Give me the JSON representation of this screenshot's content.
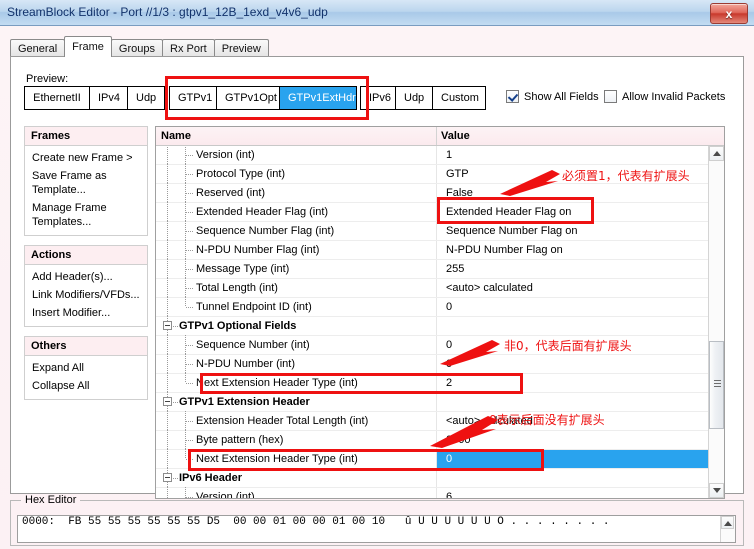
{
  "window": {
    "title": "StreamBlock Editor - Port //1/3 : gtpv1_12B_1exd_v4v6_udp",
    "close_label": "x"
  },
  "tabs": [
    {
      "label": "General",
      "active": false
    },
    {
      "label": "Frame",
      "active": true
    },
    {
      "label": "Groups",
      "active": false
    },
    {
      "label": "Rx Port",
      "active": false
    },
    {
      "label": "Preview",
      "active": false
    }
  ],
  "preview": {
    "label": "Preview:",
    "buttons": [
      {
        "label": "EthernetII",
        "selected": false
      },
      {
        "label": "IPv4",
        "selected": false
      },
      {
        "label": "Udp",
        "selected": false
      },
      {
        "label": "GTPv1",
        "selected": false
      },
      {
        "label": "GTPv1Opt",
        "selected": false
      },
      {
        "label": "GTPv1ExtHdr",
        "selected": true
      },
      {
        "label": "IPv6",
        "selected": false
      },
      {
        "label": "Udp",
        "selected": false
      },
      {
        "label": "Custom",
        "selected": false
      }
    ]
  },
  "options": {
    "show_all_fields": {
      "label": "Show All Fields",
      "checked": true
    },
    "allow_invalid_packets": {
      "label": "Allow Invalid Packets",
      "checked": false
    }
  },
  "sidebar": {
    "groups": [
      {
        "title": "Frames",
        "items": [
          {
            "label": "Create new Frame >"
          },
          {
            "label": "Save Frame as Template..."
          },
          {
            "label": "Manage Frame Templates..."
          }
        ]
      },
      {
        "title": "Actions",
        "items": [
          {
            "label": "Add Header(s)..."
          },
          {
            "label": "Link Modifiers/VFDs..."
          },
          {
            "label": "Insert Modifier..."
          }
        ]
      },
      {
        "title": "Others",
        "items": [
          {
            "label": "Expand All"
          },
          {
            "label": "Collapse All"
          }
        ]
      }
    ]
  },
  "grid": {
    "columns": {
      "name": "Name",
      "value": "Value"
    },
    "rows": [
      {
        "name": "Version (int)",
        "value": "1",
        "type": "leaf",
        "indent": 2
      },
      {
        "name": "Protocol Type (int)",
        "value": "GTP",
        "type": "leaf",
        "indent": 2
      },
      {
        "name": "Reserved (int)",
        "value": "False",
        "type": "leaf",
        "indent": 2
      },
      {
        "name": "Extended Header Flag (int)",
        "value": "Extended Header Flag on",
        "type": "leaf",
        "indent": 2
      },
      {
        "name": "Sequence Number Flag (int)",
        "value": "Sequence Number Flag on",
        "type": "leaf",
        "indent": 2
      },
      {
        "name": "N-PDU Number Flag (int)",
        "value": "N-PDU Number Flag on",
        "type": "leaf",
        "indent": 2
      },
      {
        "name": "Message Type (int)",
        "value": "255",
        "type": "leaf",
        "indent": 2
      },
      {
        "name": "Total Length (int)",
        "value": "<auto> calculated",
        "type": "leaf",
        "indent": 2,
        "auto": true
      },
      {
        "name": "Tunnel Endpoint ID (int)",
        "value": "0",
        "type": "leaf",
        "indent": 2,
        "last": true
      },
      {
        "name": "GTPv1 Optional Fields",
        "value": "",
        "type": "group",
        "indent": 1
      },
      {
        "name": "Sequence Number (int)",
        "value": "0",
        "type": "leaf",
        "indent": 2
      },
      {
        "name": "N-PDU Number (int)",
        "value": "0",
        "type": "leaf",
        "indent": 2
      },
      {
        "name": "Next Extension Header Type (int)",
        "value": "2",
        "type": "leaf",
        "indent": 2,
        "last": true
      },
      {
        "name": "GTPv1 Extension Header",
        "value": "",
        "type": "group",
        "indent": 1
      },
      {
        "name": "Extension Header Total Length (int)",
        "value": "<auto> calculated",
        "type": "leaf",
        "indent": 2,
        "auto": true
      },
      {
        "name": "Byte pattern (hex)",
        "value": "0000",
        "type": "leaf",
        "indent": 2
      },
      {
        "name": "Next Extension Header Type (int)",
        "value": "0",
        "type": "leaf",
        "indent": 2,
        "selected": true,
        "last": true
      },
      {
        "name": "IPv6 Header",
        "value": "",
        "type": "group",
        "indent": 1
      },
      {
        "name": "Version (int)",
        "value": "6",
        "type": "leaf",
        "indent": 2
      }
    ]
  },
  "annotations": [
    {
      "text": "必须置1，代表有扩展头"
    },
    {
      "text": "非0，代表后面有扩展头"
    },
    {
      "text": "0表示后面没有扩展头"
    }
  ],
  "hex_editor": {
    "legend": "Hex Editor",
    "line1": "0000:  FB 55 55 55 55 55 55 D5  00 00 01 00 00 01 00 10   û U U U U U U Õ . . . . . . . ."
  },
  "colors": {
    "accent": "#29a3ee",
    "highlight": "#ee1111"
  }
}
